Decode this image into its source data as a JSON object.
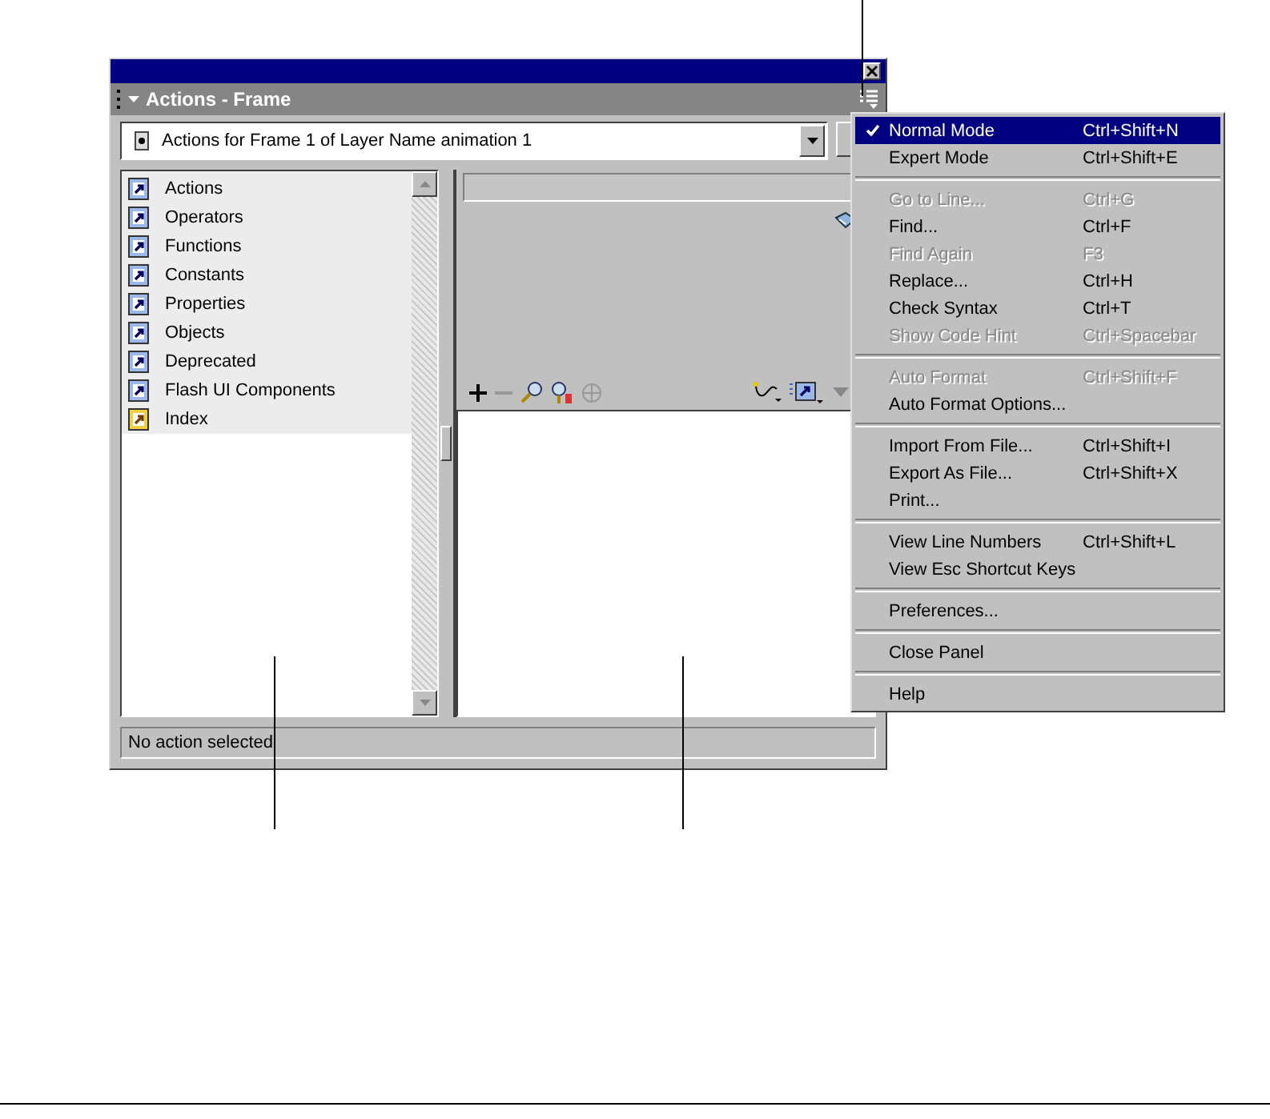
{
  "window": {
    "title": "Actions - Frame"
  },
  "target": {
    "value": "Actions for Frame 1 of Layer Name animation 1"
  },
  "toolbox": [
    {
      "kind": "book",
      "label": "Actions"
    },
    {
      "kind": "book",
      "label": "Operators"
    },
    {
      "kind": "book",
      "label": "Functions"
    },
    {
      "kind": "book",
      "label": "Constants"
    },
    {
      "kind": "book",
      "label": "Properties"
    },
    {
      "kind": "book",
      "label": "Objects"
    },
    {
      "kind": "book",
      "label": "Deprecated"
    },
    {
      "kind": "book",
      "label": "Flash UI Components"
    },
    {
      "kind": "index",
      "label": "Index"
    }
  ],
  "status_bar": "No action selected",
  "menu": [
    [
      {
        "label": "Normal Mode",
        "shortcut": "Ctrl+Shift+N",
        "checked": true,
        "selected": true,
        "disabled": false
      },
      {
        "label": "Expert Mode",
        "shortcut": "Ctrl+Shift+E",
        "checked": false,
        "selected": false,
        "disabled": false
      }
    ],
    [
      {
        "label": "Go to Line...",
        "shortcut": "Ctrl+G",
        "checked": false,
        "selected": false,
        "disabled": true
      },
      {
        "label": "Find...",
        "shortcut": "Ctrl+F",
        "checked": false,
        "selected": false,
        "disabled": false
      },
      {
        "label": "Find Again",
        "shortcut": "F3",
        "checked": false,
        "selected": false,
        "disabled": true
      },
      {
        "label": "Replace...",
        "shortcut": "Ctrl+H",
        "checked": false,
        "selected": false,
        "disabled": false
      },
      {
        "label": "Check Syntax",
        "shortcut": "Ctrl+T",
        "checked": false,
        "selected": false,
        "disabled": false
      },
      {
        "label": "Show Code Hint",
        "shortcut": "Ctrl+Spacebar",
        "checked": false,
        "selected": false,
        "disabled": true
      }
    ],
    [
      {
        "label": "Auto Format",
        "shortcut": "Ctrl+Shift+F",
        "checked": false,
        "selected": false,
        "disabled": true
      },
      {
        "label": "Auto Format Options...",
        "checked": false,
        "selected": false,
        "disabled": false
      }
    ],
    [
      {
        "label": "Import From File...",
        "shortcut": "Ctrl+Shift+I",
        "checked": false,
        "selected": false,
        "disabled": false
      },
      {
        "label": "Export As File...",
        "shortcut": "Ctrl+Shift+X",
        "checked": false,
        "selected": false,
        "disabled": false
      },
      {
        "label": "Print...",
        "checked": false,
        "selected": false,
        "disabled": false
      }
    ],
    [
      {
        "label": "View Line Numbers",
        "shortcut": "Ctrl+Shift+L",
        "checked": false,
        "selected": false,
        "disabled": false
      },
      {
        "label": "View Esc Shortcut Keys",
        "checked": false,
        "selected": false,
        "disabled": false
      }
    ],
    [
      {
        "label": "Preferences...",
        "checked": false,
        "selected": false,
        "disabled": false
      }
    ],
    [
      {
        "label": "Close Panel",
        "checked": false,
        "selected": false,
        "disabled": false
      }
    ],
    [
      {
        "label": "Help",
        "checked": false,
        "selected": false,
        "disabled": false
      }
    ]
  ]
}
